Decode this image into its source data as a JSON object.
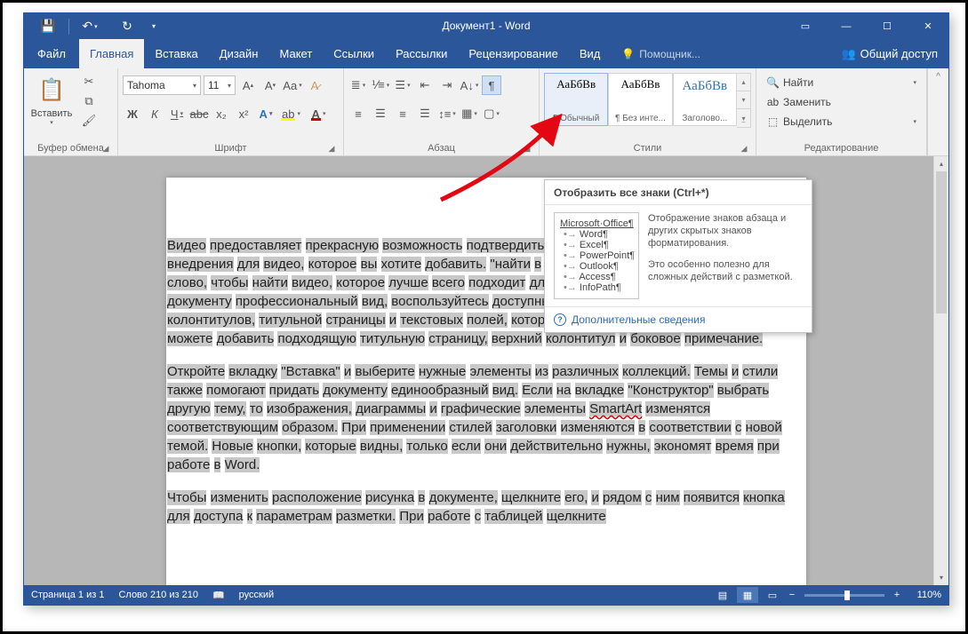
{
  "title": "Документ1 - Word",
  "tabs": {
    "file": "Файл",
    "home": "Главная",
    "insert": "Вставка",
    "design": "Дизайн",
    "layout": "Макет",
    "references": "Ссылки",
    "mailings": "Рассылки",
    "review": "Рецензирование",
    "view": "Вид"
  },
  "tellme": "Помощник...",
  "share": "Общий доступ",
  "ribbon": {
    "clipboard": {
      "label": "Буфер обмена",
      "paste": "Вставить"
    },
    "font": {
      "label": "Шрифт",
      "name": "Tahoma",
      "size": "11"
    },
    "paragraph": {
      "label": "Абзац"
    },
    "styles": {
      "label": "Стили",
      "preview": "АаБбВв",
      "items": [
        "¶ Обычный",
        "¶ Без инте...",
        "Заголово..."
      ]
    },
    "editing": {
      "label": "Редактирование",
      "find": "Найти",
      "replace": "Заменить",
      "select": "Выделить"
    }
  },
  "tooltip": {
    "title": "Отобразить все знаки (Ctrl+*)",
    "preview_title": "Microsoft·Office¶",
    "preview_items": [
      "Word¶",
      "Excel¶",
      "PowerPoint¶",
      "Outlook¶",
      "Access¶",
      "InfoPath¶"
    ],
    "desc1": "Отображение знаков абзаца и других скрытых знаков форматирования.",
    "desc2": "Это особенно полезно для сложных действий с разметкой.",
    "more": "Дополнительные сведения"
  },
  "document": {
    "p1": "Видео  предоставляет прекрасную возможность подтвердить свою точку зрения. вставить код  внедрения для видео,       которое  вы хотите добавить.       \"найти в сети\". Вы  также можете ввести ключевое слово, чтобы  найти видео, которое лучше всего подходит     для вашего документа. Чтобы придать документу профессиональный вид, воспользуйтесь доступными в Word макетами верхних и нижних колонтитулов,      титульной страницы и текстовых   полей, которые дополняют друг друга. Например,     вы можете добавить подходящую титульную страницу, верхний колонтитул и боковое примечание.",
    "p2a": "Откройте      вкладку \"Вставка\" и выберите нужные элементы из различных коллекций.             Темы и стили также помогают придать документу единообразный вид.       Если на вкладке \"Конструктор\"       выбрать другую тему, то изображения, диаграммы и графические элементы       ",
    "p2b": "SmartArt",
    "p2c": " изменятся соответствующим образом. При применении стилей заголовки изменяются в соответствии с новой темой. Новые кнопки, которые видны, только если        они действительно нужны, экономят время при работе в Word.",
    "p3": "Чтобы изменить     расположение рисунка в документе,       щелкните его, и рядом с ним появится кнопка для доступа к параметрам разметки.  При работе с таблицей щелкните"
  },
  "status": {
    "page": "Страница 1 из 1",
    "words": "Слово 210 из 210",
    "lang": "русский",
    "zoom": "110%"
  }
}
